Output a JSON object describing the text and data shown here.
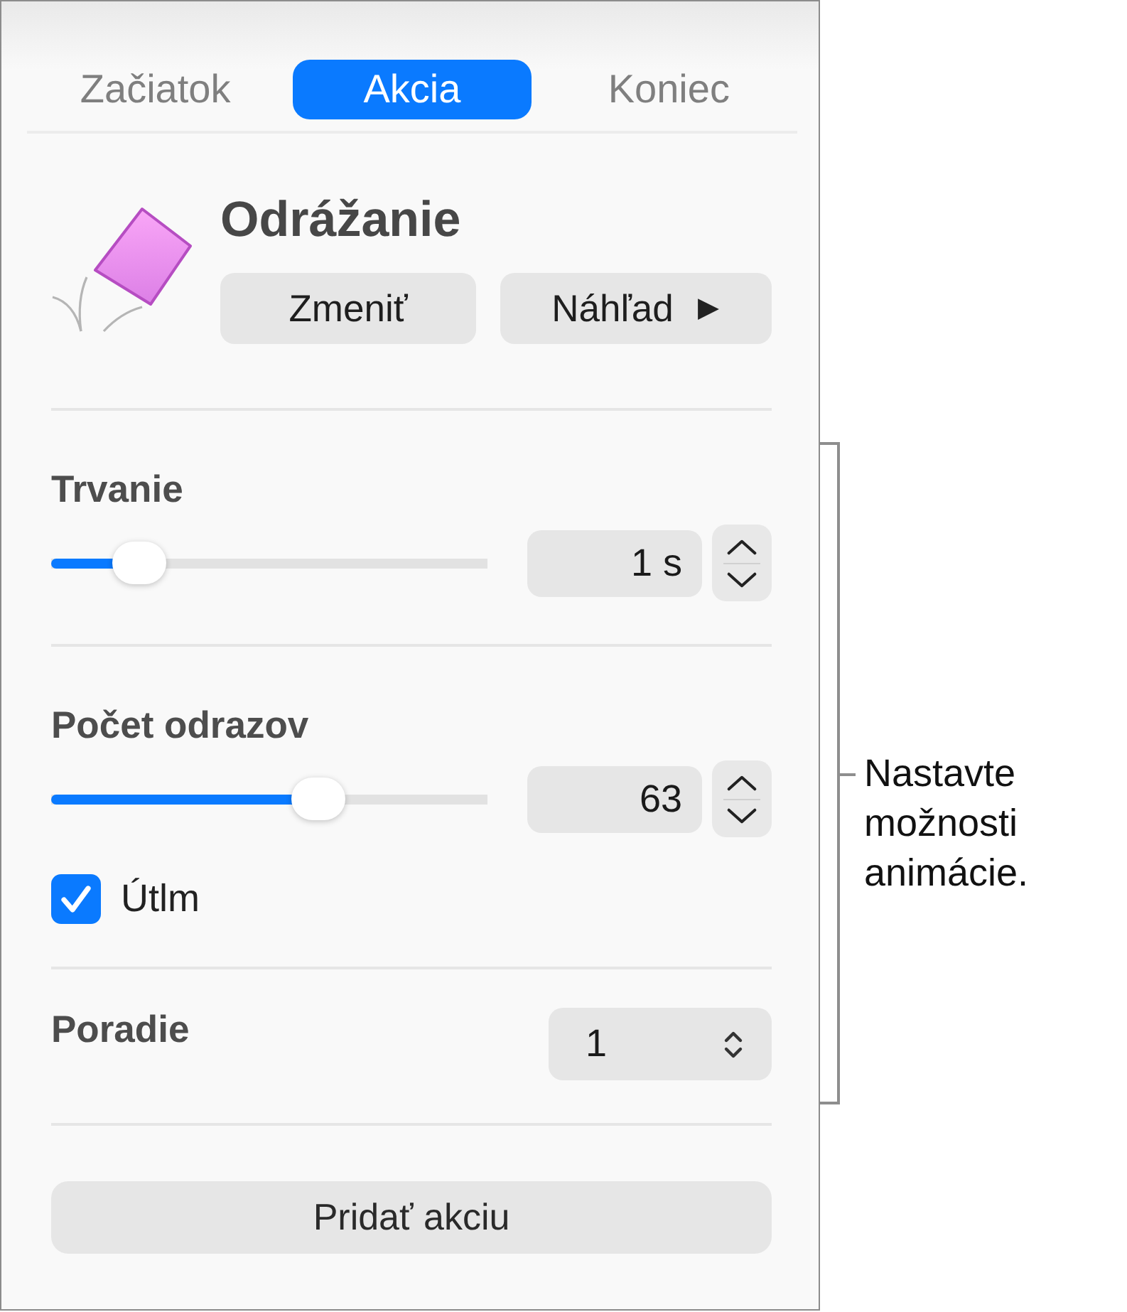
{
  "tabs": [
    {
      "label": "Začiatok",
      "selected": false
    },
    {
      "label": "Akcia",
      "selected": true
    },
    {
      "label": "Koniec",
      "selected": false
    }
  ],
  "effect": {
    "title": "Odrážanie",
    "buttons": [
      {
        "label": "Zmeniť",
        "kind": "change"
      },
      {
        "label": "Náhľad",
        "kind": "preview"
      }
    ]
  },
  "sections": [
    {
      "controls": [
        {
          "kind": "slider",
          "label": "Trvanie",
          "level": 0.16,
          "value": "1 s"
        }
      ]
    },
    {
      "controls": [
        {
          "kind": "slider",
          "label": "Počet odrazov",
          "level": 0.63,
          "value": "63"
        },
        {
          "kind": "checkbox",
          "label": "Útlm",
          "checked": true
        }
      ]
    },
    {
      "controls": [
        {
          "kind": "popup",
          "label": "Poradie",
          "value": "1"
        }
      ]
    }
  ],
  "add_button": {
    "label": "Pridať akciu"
  },
  "callout": {
    "text": "Nastavte možnosti animácie."
  }
}
